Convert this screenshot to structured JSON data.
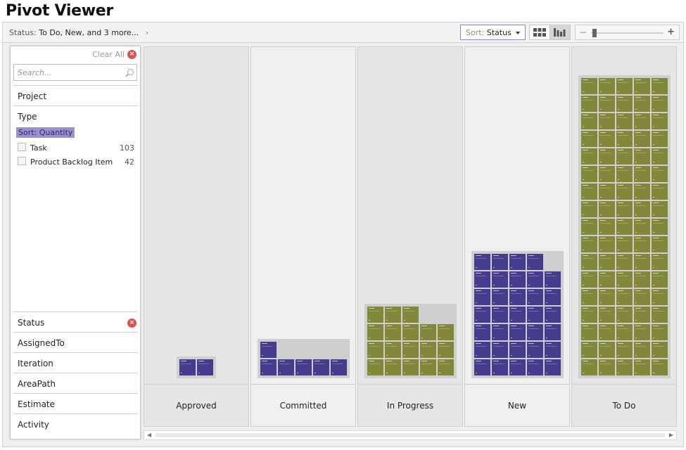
{
  "app": {
    "title": "Pivot Viewer"
  },
  "toolbar": {
    "breadcrumb_label": "Status:",
    "breadcrumb_value": "To Do, New, and 3 more...",
    "breadcrumb_chevron": "›",
    "sort_label": "Sort:",
    "sort_value": "Status"
  },
  "zoom": {
    "level": 0.02
  },
  "filter": {
    "clear_all": "Clear All",
    "search_placeholder": "Search...",
    "categories": {
      "project": "Project",
      "type": "Type",
      "status": "Status",
      "assigned_to": "AssignedTo",
      "iteration": "Iteration",
      "area_path": "AreaPath",
      "estimate": "Estimate",
      "activity": "Activity"
    },
    "type_sort": "Sort: Quantity",
    "type_options": [
      {
        "label": "Task",
        "count": "103"
      },
      {
        "label": "Product Backlog Item",
        "count": "42"
      }
    ]
  },
  "columns": [
    {
      "label": "Approved",
      "cols": 2,
      "rows": [
        [
          "p",
          "p"
        ]
      ]
    },
    {
      "label": "Committed",
      "cols": 5,
      "rows": [
        [
          "p"
        ],
        [
          "p",
          "p",
          "p",
          "p",
          "p"
        ]
      ]
    },
    {
      "label": "In Progress",
      "cols": 5,
      "rows": [
        [
          "g",
          "g",
          "g"
        ],
        [
          "g",
          "g",
          "g",
          "g",
          "g"
        ],
        [
          "g",
          "g",
          "g",
          "g",
          "g"
        ],
        [
          "g",
          "g",
          "g",
          "g",
          "g"
        ]
      ]
    },
    {
      "label": "New",
      "cols": 5,
      "rows": [
        [
          "p",
          "p",
          "p",
          "p"
        ],
        [
          "p",
          "p",
          "p",
          "p",
          "p"
        ],
        [
          "p",
          "p",
          "p",
          "p",
          "p"
        ],
        [
          "p",
          "p",
          "p",
          "p",
          "p"
        ],
        [
          "p",
          "p",
          "p",
          "p",
          "p"
        ],
        [
          "p",
          "p",
          "p",
          "p",
          "p"
        ],
        [
          "p",
          "p",
          "p",
          "p",
          "p"
        ]
      ]
    },
    {
      "label": "To Do",
      "cols": 5,
      "rows": [
        [
          "g",
          "g",
          "g",
          "g",
          "g"
        ],
        [
          "g",
          "g",
          "g",
          "g",
          "g"
        ],
        [
          "g",
          "g",
          "g",
          "g",
          "g"
        ],
        [
          "g",
          "g",
          "g",
          "g",
          "g"
        ],
        [
          "g",
          "g",
          "g",
          "g",
          "g"
        ],
        [
          "g",
          "g",
          "g",
          "g",
          "g"
        ],
        [
          "g",
          "g",
          "g",
          "g",
          "g"
        ],
        [
          "g",
          "g",
          "g",
          "g",
          "g"
        ],
        [
          "g",
          "g",
          "g",
          "g",
          "g"
        ],
        [
          "g",
          "g",
          "g",
          "g",
          "g"
        ],
        [
          "g",
          "g",
          "g",
          "g",
          "g"
        ],
        [
          "g",
          "g",
          "g",
          "g",
          "g"
        ],
        [
          "g",
          "g",
          "g",
          "g",
          "g"
        ],
        [
          "g",
          "g",
          "g",
          "g",
          "g"
        ],
        [
          "g",
          "g",
          "g",
          "g",
          "g"
        ],
        [
          "g",
          "g",
          "g",
          "g",
          "g"
        ],
        [
          "g",
          "g",
          "g",
          "g",
          "g"
        ]
      ]
    }
  ],
  "colors": {
    "purple": "#473b8e",
    "olive": "#81883a",
    "accent": "#9a92d0",
    "clear_red": "#d9534f"
  }
}
